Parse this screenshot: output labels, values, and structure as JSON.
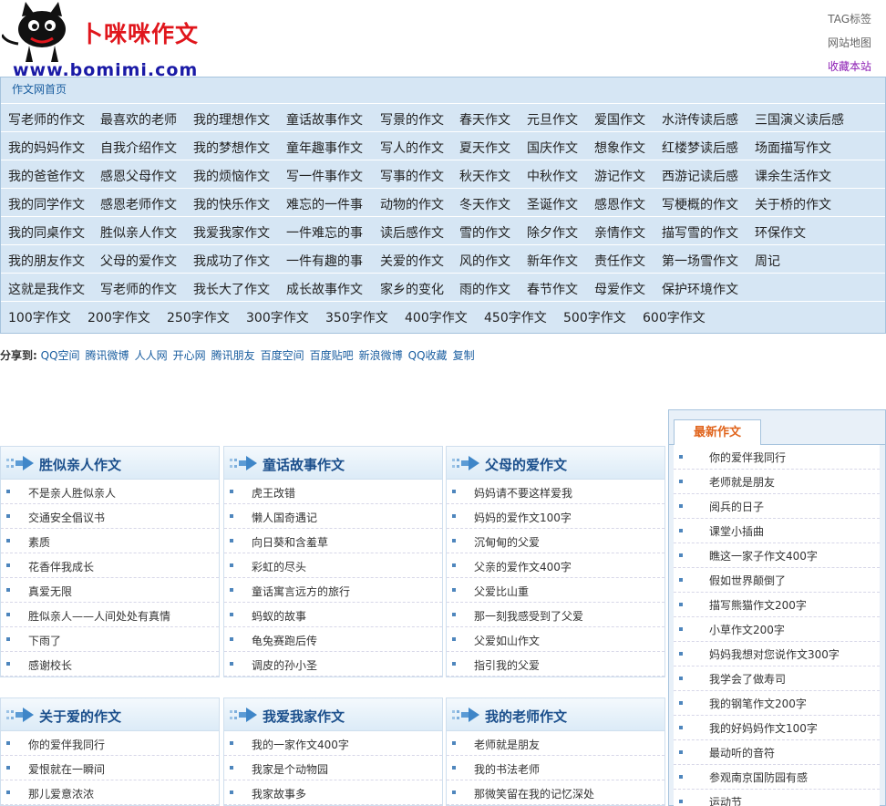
{
  "header": {
    "brand_name": "卜咪咪作文",
    "brand_url": "www.bomimi.com",
    "links": [
      "TAG标签",
      "网站地图",
      "收藏本站"
    ]
  },
  "nav": {
    "breadcrumb": "作文网首页",
    "rows": [
      [
        "写老师的作文",
        "最喜欢的老师",
        "我的理想作文",
        "童话故事作文",
        "写景的作文",
        "春天作文",
        "元旦作文",
        "爱国作文",
        "水浒传读后感",
        "三国演义读后感"
      ],
      [
        "我的妈妈作文",
        "自我介绍作文",
        "我的梦想作文",
        "童年趣事作文",
        "写人的作文",
        "夏天作文",
        "国庆作文",
        "想象作文",
        "红楼梦读后感",
        "场面描写作文"
      ],
      [
        "我的爸爸作文",
        "感恩父母作文",
        "我的烦恼作文",
        "写一件事作文",
        "写事的作文",
        "秋天作文",
        "中秋作文",
        "游记作文",
        "西游记读后感",
        "课余生活作文"
      ],
      [
        "我的同学作文",
        "感恩老师作文",
        "我的快乐作文",
        "难忘的一件事",
        "动物的作文",
        "冬天作文",
        "圣诞作文",
        "感恩作文",
        "写梗概的作文",
        "关于桥的作文"
      ],
      [
        "我的同桌作文",
        "胜似亲人作文",
        "我爱我家作文",
        "一件难忘的事",
        "读后感作文",
        "雪的作文",
        "除夕作文",
        "亲情作文",
        "描写雪的作文",
        "环保作文"
      ],
      [
        "我的朋友作文",
        "父母的爱作文",
        "我成功了作文",
        "一件有趣的事",
        "关爱的作文",
        "风的作文",
        "新年作文",
        "责任作文",
        "第一场雪作文",
        "周记"
      ],
      [
        "这就是我作文",
        "写老师的作文",
        "我长大了作文",
        "成长故事作文",
        "家乡的变化",
        "雨的作文",
        "春节作文",
        "母爱作文",
        "保护环境作文"
      ],
      [
        "100字作文",
        "200字作文",
        "250字作文",
        "300字作文",
        "350字作文",
        "400字作文",
        "450字作文",
        "500字作文",
        "600字作文"
      ]
    ]
  },
  "share": {
    "label": "分享到:",
    "items": [
      "QQ空间",
      "腾讯微博",
      "人人网",
      "开心网",
      "腾讯朋友",
      "百度空间",
      "百度贴吧",
      "新浪微博",
      "QQ收藏",
      "复制"
    ]
  },
  "boxes": [
    {
      "title": "胜似亲人作文",
      "items": [
        "不是亲人胜似亲人",
        "交通安全倡议书",
        "素质",
        "花香伴我成长",
        "真爱无限",
        "胜似亲人——人间处处有真情",
        "下雨了",
        "感谢校长"
      ]
    },
    {
      "title": "童话故事作文",
      "items": [
        "虎王改错",
        "懒人国奇遇记",
        "向日葵和含羞草",
        "彩虹的尽头",
        "童话寓言远方的旅行",
        "蚂蚁的故事",
        "龟兔赛跑后传",
        "调皮的孙小圣"
      ]
    },
    {
      "title": "父母的爱作文",
      "items": [
        "妈妈请不要这样爱我",
        "妈妈的爱作文100字",
        "沉甸甸的父爱",
        "父亲的爱作文400字",
        "父爱比山重",
        "那一刻我感受到了父爱",
        "父爱如山作文",
        "指引我的父爱"
      ]
    },
    {
      "title": "关于爱的作文",
      "items": [
        "你的爱伴我同行",
        "爱恨就在一瞬间",
        "那儿爱意浓浓"
      ]
    },
    {
      "title": "我爱我家作文",
      "items": [
        "我的一家作文400字",
        "我家是个动物园",
        "我家故事多"
      ]
    },
    {
      "title": "我的老师作文",
      "items": [
        "老师就是朋友",
        "我的书法老师",
        "那微笑留在我的记忆深处"
      ]
    }
  ],
  "sidebar": {
    "tab": "最新作文",
    "items": [
      "你的爱伴我同行",
      "老师就是朋友",
      "阅兵的日子",
      "课堂小插曲",
      "瞧这一家子作文400字",
      "假如世界颠倒了",
      "描写熊猫作文200字",
      "小草作文200字",
      "妈妈我想对您说作文300字",
      "我学会了做寿司",
      "我的钢笔作文200字",
      "我的好妈妈作文100字",
      "最动听的音符",
      "参观南京国防园有感",
      "运动节"
    ]
  }
}
